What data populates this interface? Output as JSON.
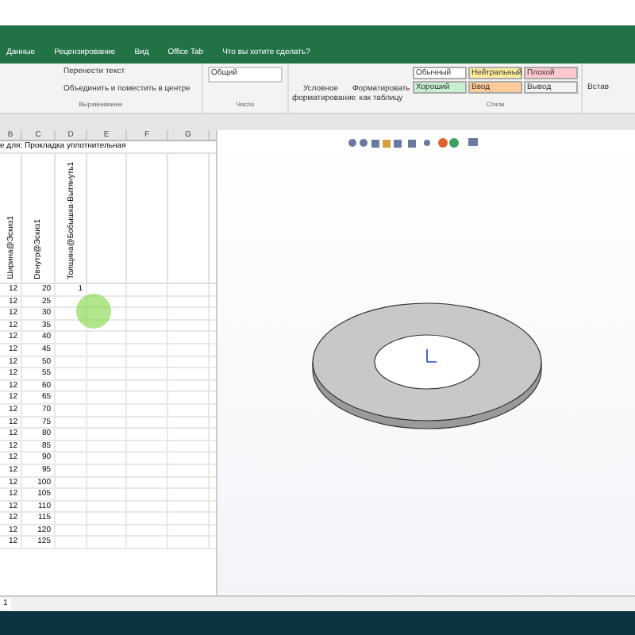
{
  "menu_tabs": [
    {
      "label": "Данные"
    },
    {
      "label": "Рецензирование"
    },
    {
      "label": "Вид"
    },
    {
      "label": "Office Tab"
    }
  ],
  "tell_me": {
    "placeholder": "Что вы хотите сделать?"
  },
  "ribbon": {
    "alignment": {
      "wrap_text": "Перенести текст",
      "merge_center": "Объединить и поместить в центре",
      "group_label": "Выравнивание"
    },
    "number": {
      "format": "Общий",
      "group_label": "Число"
    },
    "conditional_formatting": "Условное форматирование",
    "format_as_table": "Форматировать как таблицу",
    "styles": [
      {
        "label": "Обычный",
        "color": "#ffffff"
      },
      {
        "label": "Нейтральный",
        "color": "#ffeb9c"
      },
      {
        "label": "Плохой",
        "color": "#ffc7ce"
      },
      {
        "label": "Хороший",
        "color": "#c6efce"
      },
      {
        "label": "Ввод",
        "color": "#ffcc99"
      },
      {
        "label": "Вывод",
        "color": "#f2f2f2"
      }
    ],
    "styles_label": "Стили",
    "insert": "Встав"
  },
  "sheet": {
    "columns": [
      "B",
      "C",
      "D",
      "E",
      "F",
      "G"
    ],
    "title": "е для: Прокладка уплотнительная",
    "headers": [
      "Ширина@Эскиз1",
      "Dвнутр@Эскиз1",
      "Толщина@Бобышка-Вытянуть1"
    ],
    "rows": [
      [
        "12",
        "20",
        "1"
      ],
      [
        "12",
        "25"
      ],
      [
        "12",
        "30"
      ],
      [
        "12",
        "35"
      ],
      [
        "12",
        "40"
      ],
      [
        "12",
        "45"
      ],
      [
        "12",
        "50"
      ],
      [
        "12",
        "55"
      ],
      [
        "12",
        "60"
      ],
      [
        "12",
        "65"
      ],
      [
        "12",
        "70"
      ],
      [
        "12",
        "75"
      ],
      [
        "12",
        "80"
      ],
      [
        "12",
        "85"
      ],
      [
        "12",
        "90"
      ],
      [
        "12",
        "95"
      ],
      [
        "12",
        "100"
      ],
      [
        "12",
        "105"
      ],
      [
        "12",
        "110"
      ],
      [
        "12",
        "115"
      ],
      [
        "12",
        "120"
      ],
      [
        "12",
        "125"
      ]
    ],
    "sheet_tab": "1"
  }
}
